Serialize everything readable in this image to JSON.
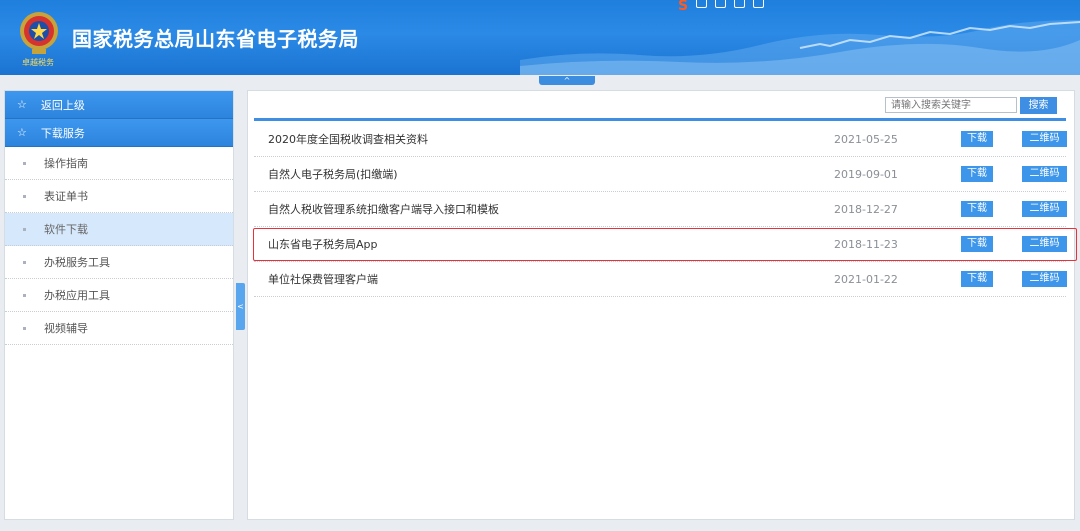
{
  "header": {
    "title": "国家税务总局山东省电子税务局",
    "slogan": "卓越税务",
    "brand_color": "#2b8ae6"
  },
  "top_toggle": {
    "symbol": "^"
  },
  "sidebar": {
    "back_label": "返回上级",
    "section_label": "下载服务",
    "items": [
      {
        "label": "操作指南"
      },
      {
        "label": "表证单书"
      },
      {
        "label": "软件下载",
        "active": true
      },
      {
        "label": "办税服务工具"
      },
      {
        "label": "办税应用工具"
      },
      {
        "label": "视频辅导"
      }
    ]
  },
  "side_handle": {
    "symbol": "<"
  },
  "search": {
    "placeholder": "请输入搜索关键字",
    "button_label": "搜索"
  },
  "downloads": {
    "download_label": "下载",
    "qrcode_label": "二维码",
    "rows": [
      {
        "name": "2020年度全国税收调查相关资料",
        "date": "2021-05-25"
      },
      {
        "name": "自然人电子税务局(扣缴端)",
        "date": "2019-09-01"
      },
      {
        "name": "自然人税收管理系统扣缴客户端导入接口和模板",
        "date": "2018-12-27"
      },
      {
        "name": "山东省电子税务局App",
        "date": "2018-11-23",
        "highlighted": true
      },
      {
        "name": "单位社保费管理客户端",
        "date": "2021-01-22"
      }
    ]
  },
  "colors": {
    "accent": "#3e8fe3",
    "highlight_border": "#e8323a"
  }
}
